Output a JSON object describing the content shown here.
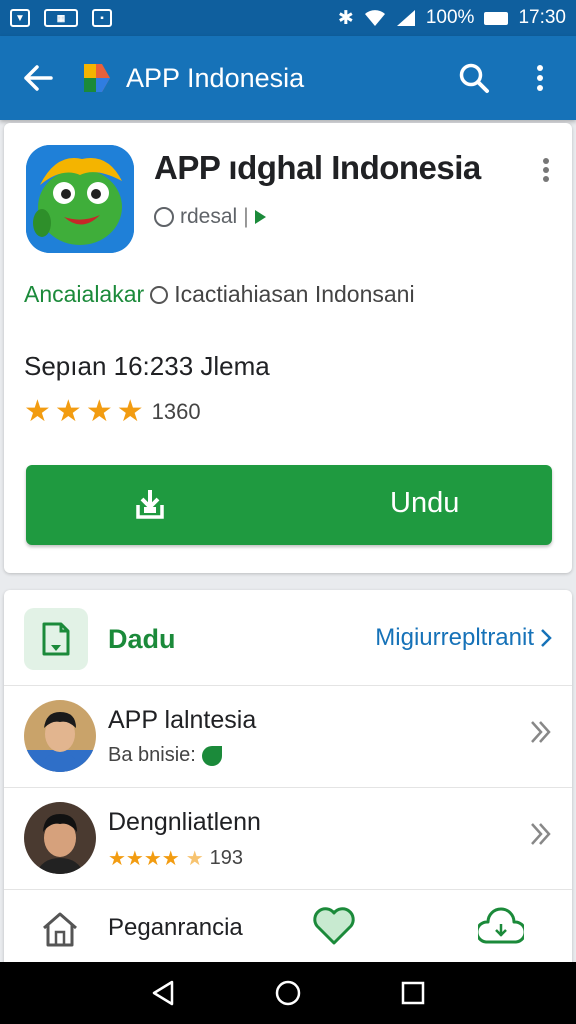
{
  "status_bar": {
    "battery_pct": "100%",
    "time": "17:30",
    "notification_icons": [
      "shield-icon",
      "keyboard-icon",
      "briefcase-icon"
    ],
    "system_icons": [
      "bluetooth-icon",
      "wifi-icon",
      "signal-icon",
      "battery-icon"
    ]
  },
  "app_bar": {
    "title": "APP Indonesia",
    "background": "#1672b8",
    "icons": [
      "back-arrow-icon",
      "app-logo",
      "search-icon",
      "more-vert-icon"
    ]
  },
  "app_card": {
    "name": "APP ıdghal Indonesia",
    "developer": "rdesal",
    "category": "Ancaialakar",
    "category_sub": "Icactiahiasan Indonsani",
    "release": "Sepıan 16:233 Jlema",
    "rating_value": 4,
    "rating_max": 5,
    "rating_count": "1360",
    "install_label": "Undu",
    "install_color": "#1f9a40"
  },
  "section": {
    "title": "Dadu",
    "link": "Migiurrepltranit",
    "accent": "#1b8a3a"
  },
  "list": [
    {
      "title": "APP lalntesia",
      "subtitle": "Ba bnisie:"
    },
    {
      "title": "Dengnliatlenn",
      "subtitle": "193",
      "rating_value": 4.5
    }
  ],
  "bottom_nav": {
    "label": "Peganrancia",
    "icons": [
      "home-icon",
      "heart-icon",
      "cloud-icon"
    ]
  },
  "system_nav": {
    "icons": [
      "back-triangle-icon",
      "home-circle-icon",
      "recents-square-icon"
    ]
  }
}
